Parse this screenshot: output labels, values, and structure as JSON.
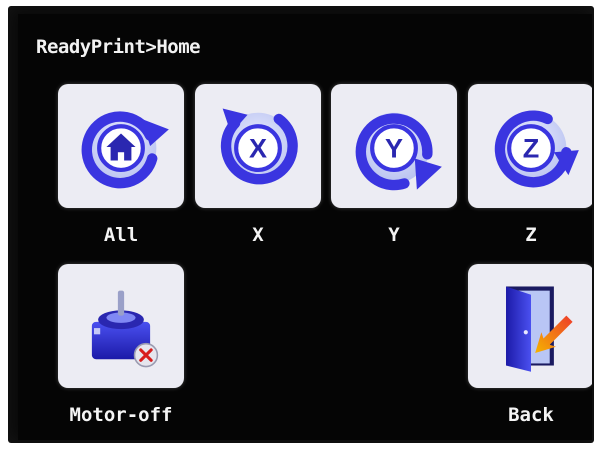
{
  "breadcrumb": "ReadyPrint>Home",
  "buttons": {
    "all": {
      "label": "All",
      "icon": "home-rotate-icon"
    },
    "x": {
      "label": "X",
      "icon": "rotate-x-icon",
      "glyph": "X"
    },
    "y": {
      "label": "Y",
      "icon": "rotate-y-icon",
      "glyph": "Y"
    },
    "z": {
      "label": "Z",
      "icon": "rotate-z-icon",
      "glyph": "Z"
    },
    "motor_off": {
      "label": "Motor-off",
      "icon": "stepper-motor-off-icon"
    },
    "back": {
      "label": "Back",
      "icon": "exit-door-icon"
    }
  },
  "colors": {
    "accent": "#3a35e0",
    "tile": "#ececf3",
    "screen": "#050505",
    "text": "#f2f2f2"
  }
}
